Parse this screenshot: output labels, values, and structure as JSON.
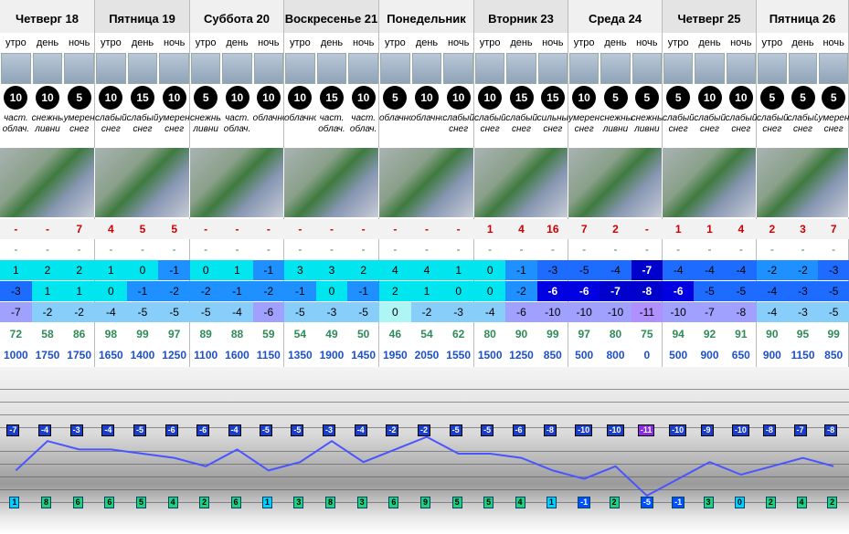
{
  "days": [
    "Четверг 18",
    "Пятница 19",
    "Суббота 20",
    "Воскресенье 21",
    "Понедельник 22",
    "Вторник 23",
    "Среда 24",
    "Четверг 25",
    "Пятница 26"
  ],
  "parts": [
    "утро",
    "день",
    "ночь"
  ],
  "wind": [
    "10",
    "10",
    "5",
    "10",
    "15",
    "10",
    "5",
    "10",
    "10",
    "10",
    "15",
    "10",
    "5",
    "10",
    "10",
    "10",
    "15",
    "15",
    "10",
    "5",
    "5",
    "5",
    "10",
    "10",
    "5",
    "5",
    "5"
  ],
  "icons": [
    "partly-cloudy-icon",
    "snow-icon",
    "snow-night-icon",
    "snow-icon",
    "snow-icon",
    "snow-night-icon",
    "partly-cloudy-icon",
    "partly-cloudy-icon",
    "cloud-night-icon",
    "cloud-icon",
    "sun-cloud-icon",
    "moon-icon",
    "cloud-icon",
    "cloud-icon",
    "snow-night-icon",
    "snow-icon",
    "snow-icon",
    "snow-night-icon",
    "snow-icon",
    "snow-icon",
    "moon-icon",
    "snow-icon",
    "snow-icon",
    "snow-night-icon",
    "snow-icon",
    "snow-icon",
    "snow-night-icon"
  ],
  "conditions": [
    "част. облач.",
    "снежные ливни",
    "умерен снег",
    "слабый снег",
    "слабый снег",
    "умерен снег",
    "снежные ливни",
    "част. облач.",
    "облачно",
    "облачно",
    "част. облач.",
    "част. облач.",
    "облачно",
    "облачно",
    "слабый снег",
    "слабый снег",
    "слабый снег",
    "сильный снег",
    "умерен снег",
    "снежные ливни",
    "снежные ливни",
    "слабый снег",
    "слабый снег",
    "слабый снег",
    "слабый снег",
    "слабый снег",
    "умерен снег"
  ],
  "precip": [
    "-",
    "-",
    "7",
    "4",
    "5",
    "5",
    "-",
    "-",
    "-",
    "-",
    "-",
    "-",
    "-",
    "-",
    "-",
    "1",
    "4",
    "16",
    "7",
    "2",
    "-",
    "1",
    "1",
    "4",
    "2",
    "3",
    "7"
  ],
  "dashes": [
    "-",
    "-",
    "-",
    "-",
    "-",
    "-",
    "-",
    "-",
    "-",
    "-",
    "-",
    "-",
    "-",
    "-",
    "-",
    "-",
    "-",
    "-",
    "-",
    "-",
    "-",
    "-",
    "-",
    "-",
    "-",
    "-",
    "-"
  ],
  "temp1": [
    "1",
    "2",
    "2",
    "1",
    "0",
    "-1",
    "0",
    "1",
    "-1",
    "3",
    "3",
    "2",
    "4",
    "4",
    "1",
    "0",
    "-1",
    "-3",
    "-5",
    "-4",
    "-7",
    "-4",
    "-4",
    "-4",
    "-2",
    "-2",
    "-3"
  ],
  "temp2": [
    "-3",
    "1",
    "1",
    "0",
    "-1",
    "-2",
    "-2",
    "-1",
    "-2",
    "-1",
    "0",
    "-1",
    "2",
    "1",
    "0",
    "0",
    "-2",
    "-6",
    "-6",
    "-7",
    "-8",
    "-6",
    "-5",
    "-5",
    "-4",
    "-3",
    "-5"
  ],
  "temp3": [
    "-7",
    "-2",
    "-2",
    "-4",
    "-5",
    "-5",
    "-5",
    "-4",
    "-6",
    "-5",
    "-3",
    "-5",
    "0",
    "-2",
    "-3",
    "-4",
    "-6",
    "-10",
    "-10",
    "-10",
    "-11",
    "-10",
    "-7",
    "-8",
    "-4",
    "-3",
    "-5"
  ],
  "humidity": [
    "72",
    "58",
    "86",
    "98",
    "99",
    "97",
    "89",
    "88",
    "59",
    "54",
    "49",
    "50",
    "46",
    "54",
    "62",
    "80",
    "90",
    "99",
    "97",
    "80",
    "75",
    "94",
    "92",
    "91",
    "90",
    "95",
    "99"
  ],
  "snowline": [
    "1000",
    "1750",
    "1750",
    "1650",
    "1400",
    "1250",
    "1100",
    "1600",
    "1150",
    "1350",
    "1900",
    "1450",
    "1950",
    "2050",
    "1550",
    "1500",
    "1250",
    "850",
    "500",
    "800",
    "0",
    "500",
    "900",
    "650",
    "900",
    "1150",
    "850"
  ],
  "chart_data": {
    "type": "line",
    "upper_labels": [
      "-7",
      "-4",
      "-3",
      "-4",
      "-5",
      "-6",
      "-6",
      "-4",
      "-5",
      "-5",
      "-3",
      "-4",
      "-2",
      "-2",
      "-5",
      "-5",
      "-6",
      "-8",
      "-10",
      "-10",
      "-11",
      "-10",
      "-9",
      "-10",
      "-8",
      "-7",
      "-8"
    ],
    "lower_labels": [
      "1",
      "8",
      "6",
      "6",
      "5",
      "4",
      "2",
      "6",
      "1",
      "3",
      "8",
      "3",
      "6",
      "9",
      "5",
      "5",
      "4",
      "1",
      "-1",
      "2",
      "-5",
      "-1",
      "3",
      "0",
      "2",
      "4",
      "2"
    ],
    "series": [
      {
        "values": [
          1,
          8,
          6,
          6,
          5,
          4,
          2,
          6,
          1,
          3,
          8,
          3,
          6,
          9,
          5,
          5,
          4,
          1,
          -1,
          2,
          -5,
          -1,
          3,
          0,
          2,
          4,
          2
        ]
      }
    ]
  }
}
